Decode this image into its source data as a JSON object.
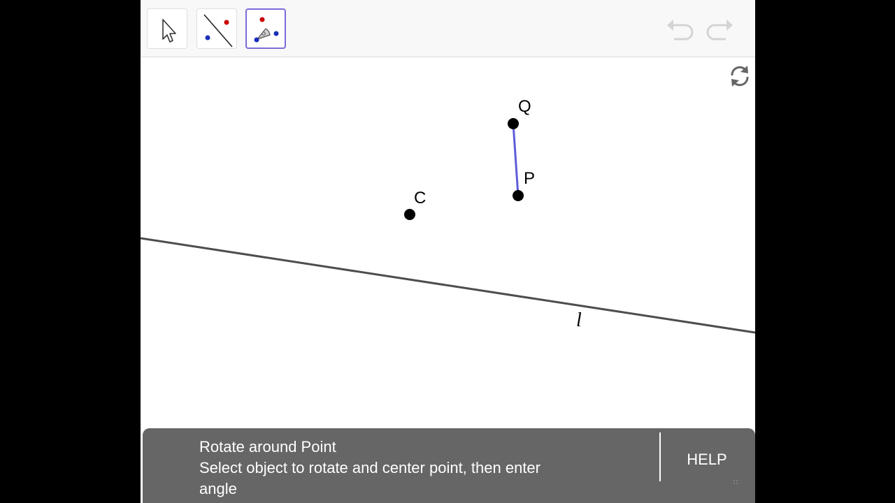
{
  "toolbar": {
    "tools": [
      {
        "id": "move",
        "icon": "cursor-arrow-icon",
        "selected": false
      },
      {
        "id": "line",
        "icon": "line-through-points-icon",
        "selected": false
      },
      {
        "id": "rotate",
        "icon": "rotate-around-point-icon",
        "selected": true
      }
    ],
    "accent_color": "#7b6cd9"
  },
  "history": {
    "undo_icon": "undo-icon",
    "redo_icon": "redo-icon"
  },
  "graphics": {
    "reset_icon": "reset-icon",
    "points": [
      {
        "label": "Q"
      },
      {
        "label": "P"
      },
      {
        "label": "C"
      }
    ],
    "segment": {
      "from": "Q",
      "to": "P",
      "color": "#5d5ddb"
    },
    "line": {
      "label": "l",
      "color": "#4d4d4d"
    }
  },
  "message": {
    "title": "Rotate around Point",
    "line1": "Select object to rotate and center point, then enter",
    "line2": "angle",
    "help_label": "HELP"
  }
}
